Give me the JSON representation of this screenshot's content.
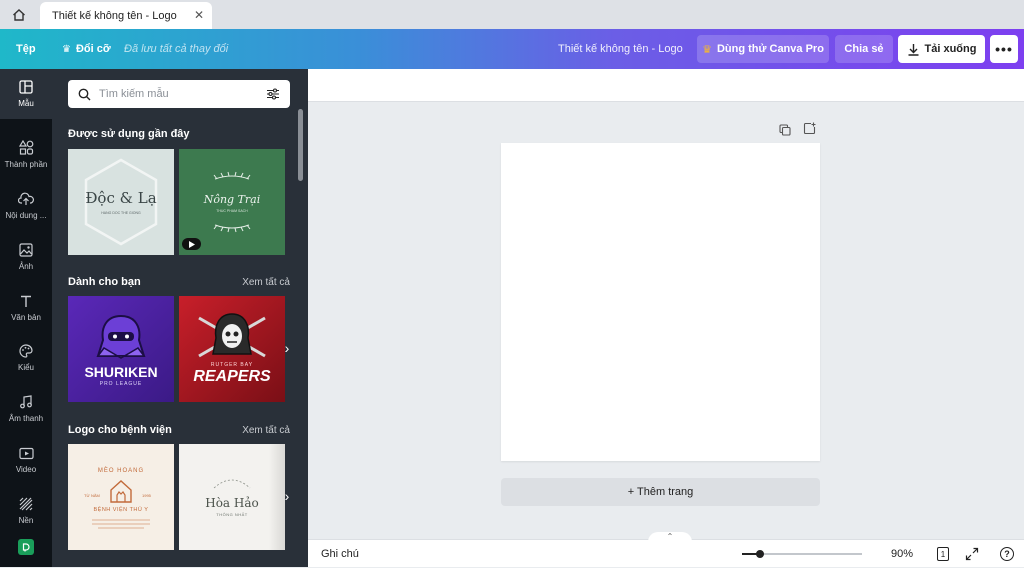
{
  "browser": {
    "tab_title": "Thiết kế không tên - Logo",
    "close_glyph": "✕"
  },
  "toolbar": {
    "file_label": "Tệp",
    "resize_label": "Đổi cỡ",
    "saved_status": "Đã lưu tất cả thay đổi",
    "doc_title": "Thiết kế không tên - Logo",
    "try_pro_label": "Dùng thử Canva Pro",
    "share_label": "Chia sẻ",
    "download_label": "Tải xuống",
    "more_glyph": "•••",
    "colors": {
      "gradient_start": "#1fb8c9",
      "gradient_end": "#7d3ff0"
    }
  },
  "rail": {
    "items": [
      {
        "label": "Mẫu",
        "icon": "template-icon",
        "active": true
      },
      {
        "label": "Thành phần",
        "icon": "elements-icon"
      },
      {
        "label": "Nội dung ...",
        "icon": "upload-icon"
      },
      {
        "label": "Ảnh",
        "icon": "photo-icon"
      },
      {
        "label": "Văn bản",
        "icon": "text-icon"
      },
      {
        "label": "Kiểu",
        "icon": "palette-icon"
      },
      {
        "label": "Âm thanh",
        "icon": "music-icon"
      },
      {
        "label": "Video",
        "icon": "video-icon"
      },
      {
        "label": "Nền",
        "icon": "background-icon"
      }
    ]
  },
  "panel": {
    "search_placeholder": "Tìm kiếm mẫu",
    "sections": [
      {
        "title": "Được sử dụng gần đây",
        "thumbs": [
          {
            "title": "Độc & Lạ",
            "subtitle": "HANG DOC THE GIONG"
          },
          {
            "title": "Nông Trại",
            "subtitle": "THUC PHAM SACH"
          }
        ]
      },
      {
        "title": "Dành cho bạn",
        "see_all": "Xem tất cả",
        "thumbs": [
          {
            "title": "SHURIKEN",
            "subtitle": "PRO LEAGUE"
          },
          {
            "title": "REAPERS",
            "subtitle": "RUTGER BAY"
          }
        ]
      },
      {
        "title": "Logo cho bệnh viện",
        "see_all": "Xem tất cả",
        "thumbs": [
          {
            "title": "BỆNH VIỆN THÚ Y",
            "subtitle": "MÈO HOANG",
            "year_left": "TỪ NĂM",
            "year_right": "1995"
          },
          {
            "title": "Hòa Hảo",
            "subtitle": "THÔNG NHẤT"
          }
        ]
      }
    ]
  },
  "canvas": {
    "add_page_label": "+ Thêm trang"
  },
  "bottombar": {
    "notes_label": "Ghi chú",
    "zoom_value": "90%",
    "zoom_level": 0.15,
    "page_count": "1",
    "help_glyph": "?"
  }
}
